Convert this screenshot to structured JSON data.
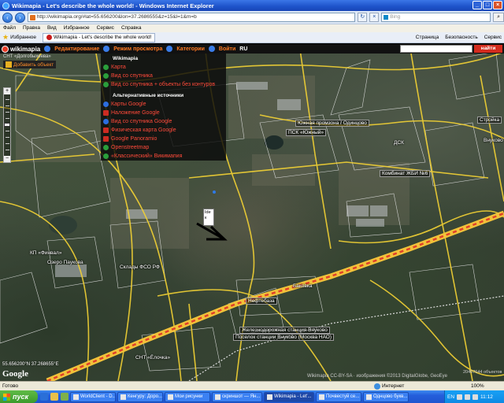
{
  "window": {
    "title": "Wikimapia - Let's describe the whole world! - Windows Internet Explorer",
    "controls": [
      "_",
      "□",
      "×"
    ]
  },
  "address": {
    "url": "http://wikimapia.org/#lat=55.656200&lon=37.2686555&z=15&l=1&m=b",
    "search_placeholder": "Bing"
  },
  "menu": [
    "Файл",
    "Правка",
    "Вид",
    "Избранное",
    "Сервис",
    "Справка"
  ],
  "favorites": {
    "label": "Избранное",
    "tab_title": "Wikimapia - Let's describe the whole world!",
    "tools": [
      "Страница",
      "Безопасность",
      "Сервис"
    ]
  },
  "wikimapia": {
    "logo": "wikimapia",
    "edit": "Редактирование",
    "view_modes": "Режим просмотра",
    "categories": "Категории",
    "login": "Войти",
    "lang": "RU",
    "search_button": "найти",
    "subtitle": "СНТ «Долгобыхеева»",
    "add_object": "Добавить объект"
  },
  "view_menu": {
    "header1": "Wikimapia",
    "items1": [
      "Карта",
      "Вид со спутника",
      "Вид со спутника + объекты без контуров"
    ],
    "header2": "Альтернативные источники",
    "items2": [
      "Карты Google",
      "Наложение Google",
      "Вид со спутника Google",
      "Физическая карта Google",
      "Google Panoramio",
      "Openstreetmap",
      "«Классический» Викимапия"
    ]
  },
  "map_labels": [
    {
      "text": "Южная промзона / Одинцово",
      "cls": "box"
    },
    {
      "text": "ПСК «Южный»",
      "cls": "box"
    },
    {
      "text": "Комбинат ЖБИ №6",
      "cls": "box"
    },
    {
      "text": "Стройка",
      "cls": "box"
    },
    {
      "text": "Внуково",
      "cls": ""
    },
    {
      "text": "Озеро Паукова",
      "cls": ""
    },
    {
      "text": "Склады ФСО РФ",
      "cls": ""
    },
    {
      "text": "Нефтебаза",
      "cls": "box"
    },
    {
      "text": "Железнодорожная станция Внуково",
      "cls": "box"
    },
    {
      "text": "Поселок станции Внуково (Москва НАО)",
      "cls": "box"
    },
    {
      "text": "Баковка",
      "cls": ""
    },
    {
      "text": "СНТ «Ёлочка»",
      "cls": ""
    },
    {
      "text": "ДСК",
      "cls": ""
    },
    {
      "text": "КП «Финвал»",
      "cls": ""
    }
  ],
  "popup_text": "Ide к",
  "coords": "55.656200°N 37.268655°E",
  "google_logo": "Google",
  "copyright": "Wikimapia CC-BY-SA · изображения ©2013 DigitalGlobe, GeoEye",
  "obj_count": "20467644 объектов",
  "status": {
    "left": "Готово",
    "zone": "Интернет",
    "zoom": "100%"
  },
  "taskbar": {
    "start": "пуск",
    "tasks": [
      "WorldClient - D...",
      "Кенгуру: Доро...",
      "Мои рисунки",
      "скриншот — Ян...",
      "Wikimapia - Let'...",
      "Почвестуй се...",
      "Однцово букв..."
    ],
    "active_index": 4,
    "lang": "EN",
    "clock": "11:12"
  }
}
